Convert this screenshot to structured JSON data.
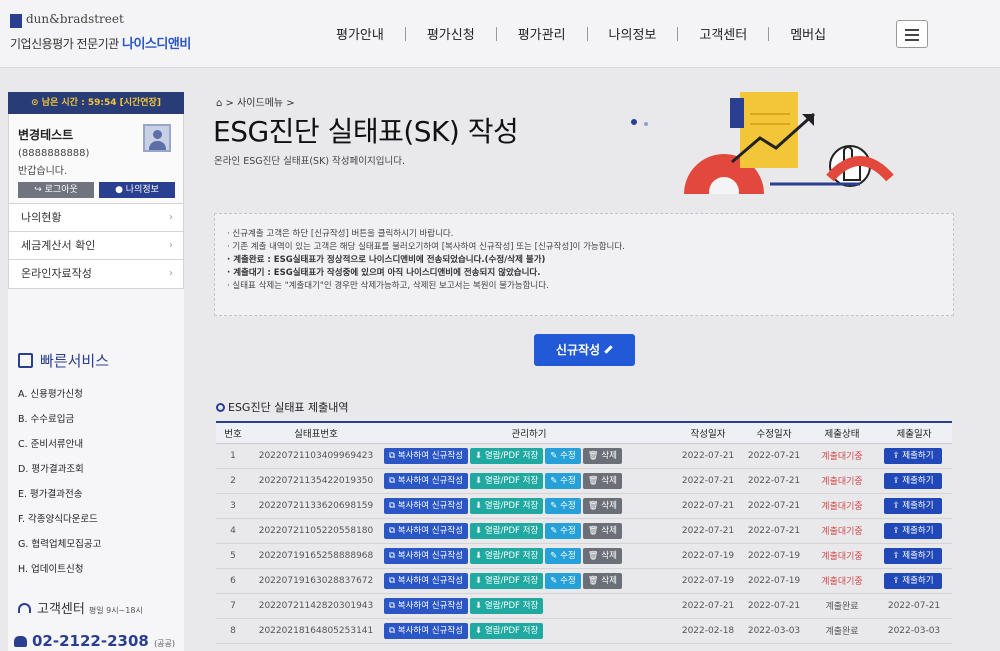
{
  "header": {
    "brand": "dun&bradstreet",
    "tagline": "기업신용평가 전문기관",
    "company": "나이스디앤비",
    "nav": [
      "평가안내",
      "평가신청",
      "평가관리",
      "나의정보",
      "고객센터",
      "멤버십"
    ]
  },
  "sidebar": {
    "timer": "⊙ 남은 시간 : 59:54 [시간연장]",
    "user_name": "변경테스트",
    "user_id": "(8888888888)",
    "greeting": "반갑습니다.",
    "logout_label": "로그아웃",
    "myinfo_label": "나의정보",
    "nav": [
      "나의현황",
      "세금계산서 확인",
      "온라인자료작성"
    ],
    "quick_title": "빠른서비스",
    "quick_items": [
      "A. 신용평가신청",
      "B. 수수료입금",
      "C. 준비서류안내",
      "D. 평가결과조회",
      "E. 평가결과전송",
      "F. 각종양식다운로드",
      "G. 협력업체모집공고",
      "H. 업데이트신청"
    ],
    "cs_title": "고객센터",
    "cs_hours": "평일 9시~18시",
    "cs_phone": "02-2122-2308",
    "cs_phone_note": "(공공)"
  },
  "main": {
    "breadcrumb": "사이드메뉴",
    "title": "ESG진단 실태표(SK) 작성",
    "description": "온라인 ESG진단 실태표(SK) 작성페이지입니다.",
    "notices": [
      {
        "text": "· 신규계출 고객은 하단 [신규작성] 버튼을 클릭하시기 바랍니다.",
        "em": false
      },
      {
        "text": "· 기존 계출 내역이 있는 고객은 해당 실태표를 불러오기하여 [복사하여 신규작성] 또는 [신규작성]이 가능합니다.",
        "em": false
      },
      {
        "text": "· 계출완료 : ESG실태표가 정상적으로 나이스디앤비에 전송되었습니다.(수정/삭제 불가)",
        "em": true
      },
      {
        "text": "· 계출대기 : ESG실태표가 작성중에 있으며 아직 나이스디앤비에 전송되지 않았습니다.",
        "em": true
      },
      {
        "text": "· 실태표 삭제는 \"계출대기\"인 경우만 삭제가능하고, 삭제된 보고서는 복원이 불가능합니다.",
        "em": false
      }
    ],
    "new_button": "신규작성",
    "section_title": "ESG진단 실태표 제출내역"
  },
  "table": {
    "headers": [
      "번호",
      "실태표번호",
      "관리하기",
      "작성일자",
      "수정일자",
      "제출상태",
      "제출일자"
    ],
    "action_labels": {
      "copy": "복사하여 신규작성",
      "view": "열람/PDF 저장",
      "edit": "수정",
      "delete": "삭제",
      "submit": "제출하기"
    },
    "rows": [
      {
        "no": "1",
        "id": "20220721103409969423",
        "created": "2022-07-21",
        "modified": "2022-07-21",
        "status": "계출대기중",
        "submitted": ""
      },
      {
        "no": "2",
        "id": "20220721135422019350",
        "created": "2022-07-21",
        "modified": "2022-07-21",
        "status": "계출대기중",
        "submitted": ""
      },
      {
        "no": "3",
        "id": "20220721133620698159",
        "created": "2022-07-21",
        "modified": "2022-07-21",
        "status": "계출대기중",
        "submitted": ""
      },
      {
        "no": "4",
        "id": "20220721105220558180",
        "created": "2022-07-21",
        "modified": "2022-07-21",
        "status": "계출대기중",
        "submitted": ""
      },
      {
        "no": "5",
        "id": "20220719165258888968",
        "created": "2022-07-19",
        "modified": "2022-07-19",
        "status": "계출대기중",
        "submitted": ""
      },
      {
        "no": "6",
        "id": "20220719163028837672",
        "created": "2022-07-19",
        "modified": "2022-07-19",
        "status": "계출대기중",
        "submitted": ""
      },
      {
        "no": "7",
        "id": "20220721142820301943",
        "created": "2022-07-21",
        "modified": "2022-07-21",
        "status": "계출완료",
        "submitted": "2022-07-21"
      },
      {
        "no": "8",
        "id": "20220218164805253141",
        "created": "2022-02-18",
        "modified": "2022-03-03",
        "status": "계출완료",
        "submitted": "2022-03-03"
      }
    ]
  },
  "colors": {
    "primary": "#2a3f8f",
    "accent": "#2159d6",
    "pending": "#d24a4a",
    "teal": "#1fa9a0"
  }
}
